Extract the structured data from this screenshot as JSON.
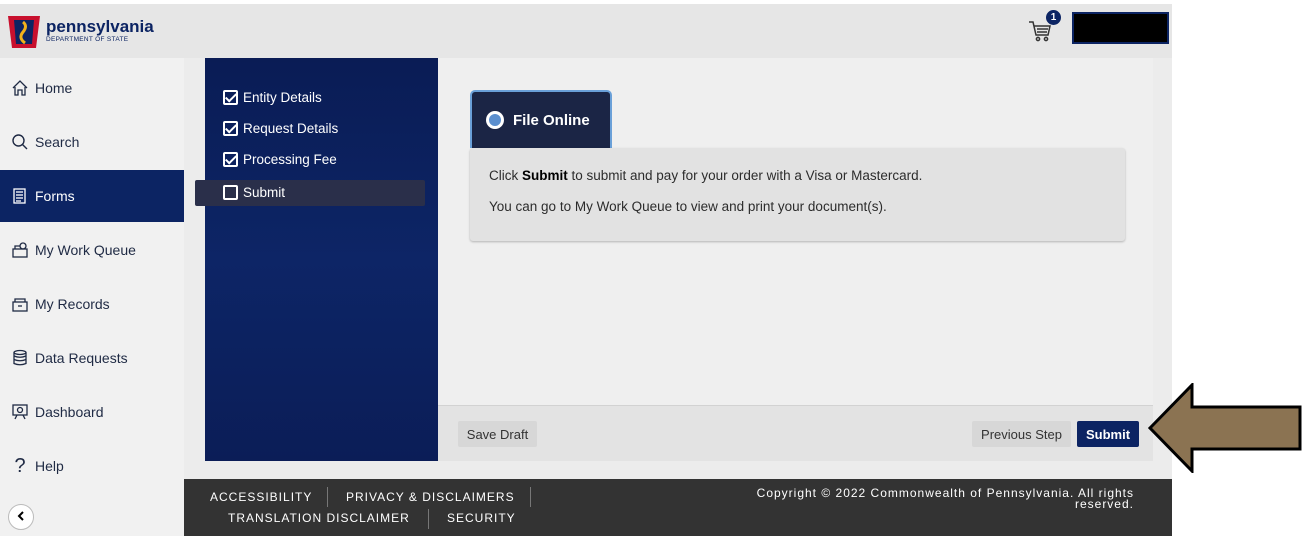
{
  "header": {
    "logo_title": "pennsylvania",
    "logo_subtitle": "DEPARTMENT OF STATE",
    "cart_count": "1"
  },
  "sidebar": {
    "items": [
      {
        "label": "Home",
        "icon": "home-icon"
      },
      {
        "label": "Search",
        "icon": "search-icon"
      },
      {
        "label": "Forms",
        "icon": "forms-icon",
        "active": true
      },
      {
        "label": "My Work Queue",
        "icon": "work-queue-icon"
      },
      {
        "label": "My Records",
        "icon": "records-icon"
      },
      {
        "label": "Data Requests",
        "icon": "database-icon"
      },
      {
        "label": "Dashboard",
        "icon": "dashboard-icon"
      },
      {
        "label": "Help",
        "icon": "help-icon"
      }
    ]
  },
  "steps": [
    {
      "label": "Entity Details",
      "checked": true
    },
    {
      "label": "Request Details",
      "checked": true
    },
    {
      "label": "Processing Fee",
      "checked": true
    },
    {
      "label": "Submit",
      "checked": false,
      "active": true
    }
  ],
  "main": {
    "tab_label": "File Online",
    "info_line1_prefix": "Click ",
    "info_line1_bold": "Submit",
    "info_line1_suffix": " to submit and pay for your order with a Visa or Mastercard.",
    "info_line2": "You can go to My Work Queue to view and print your document(s)."
  },
  "actions": {
    "save_draft": "Save Draft",
    "previous_step": "Previous Step",
    "submit": "Submit"
  },
  "footer": {
    "accessibility": "ACCESSIBILITY",
    "privacy": "PRIVACY & DISCLAIMERS",
    "translation": "TRANSLATION DISCLAIMER",
    "security": "SECURITY",
    "copyright": "Copyright © 2022 Commonwealth of Pennsylvania. All rights reserved."
  },
  "colors": {
    "brand_navy": "#0c2463",
    "arrow_fill": "#8b7352",
    "footer_bg": "#333333"
  }
}
